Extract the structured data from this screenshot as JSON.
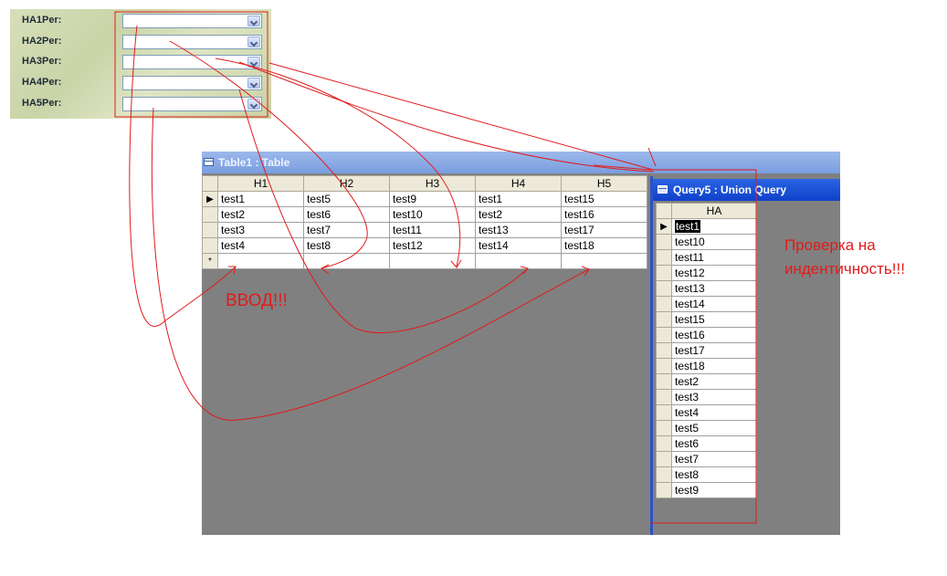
{
  "form": {
    "fields": [
      {
        "label": "HA1Per:",
        "value": ""
      },
      {
        "label": "HA2Per:",
        "value": ""
      },
      {
        "label": "HA3Per:",
        "value": ""
      },
      {
        "label": "HA4Per:",
        "value": ""
      },
      {
        "label": "HA5Per:",
        "value": ""
      }
    ]
  },
  "table_window": {
    "title": "Table1 : Table",
    "columns": [
      "H1",
      "H2",
      "H3",
      "H4",
      "H5"
    ],
    "rows": [
      [
        "test1",
        "test5",
        "test9",
        "test1",
        "test15"
      ],
      [
        "test2",
        "test6",
        "test10",
        "test2",
        "test16"
      ],
      [
        "test3",
        "test7",
        "test11",
        "test13",
        "test17"
      ],
      [
        "test4",
        "test8",
        "test12",
        "test14",
        "test18"
      ]
    ],
    "current_row_marker": "▶",
    "new_row_marker": "*"
  },
  "query_window": {
    "title": "Query5 : Union Query",
    "column": "HA",
    "rows": [
      "test1",
      "test10",
      "test11",
      "test12",
      "test13",
      "test14",
      "test15",
      "test16",
      "test17",
      "test18",
      "test2",
      "test3",
      "test4",
      "test5",
      "test6",
      "test7",
      "test8",
      "test9"
    ],
    "current_row_marker": "▶"
  },
  "annotations": {
    "input_label": "ВВОД!!!",
    "check_label": "Проверка на инде нтичность!!!",
    "check_line1": "Проверка на",
    "check_line2": "индентичность!!!",
    "color": "#e01b1b"
  },
  "colors": {
    "xp_title_active": "#1041c9",
    "xp_title_inactive": "#7a9de0",
    "mdi_background": "#808080",
    "form_background": "#d0d9b0"
  }
}
